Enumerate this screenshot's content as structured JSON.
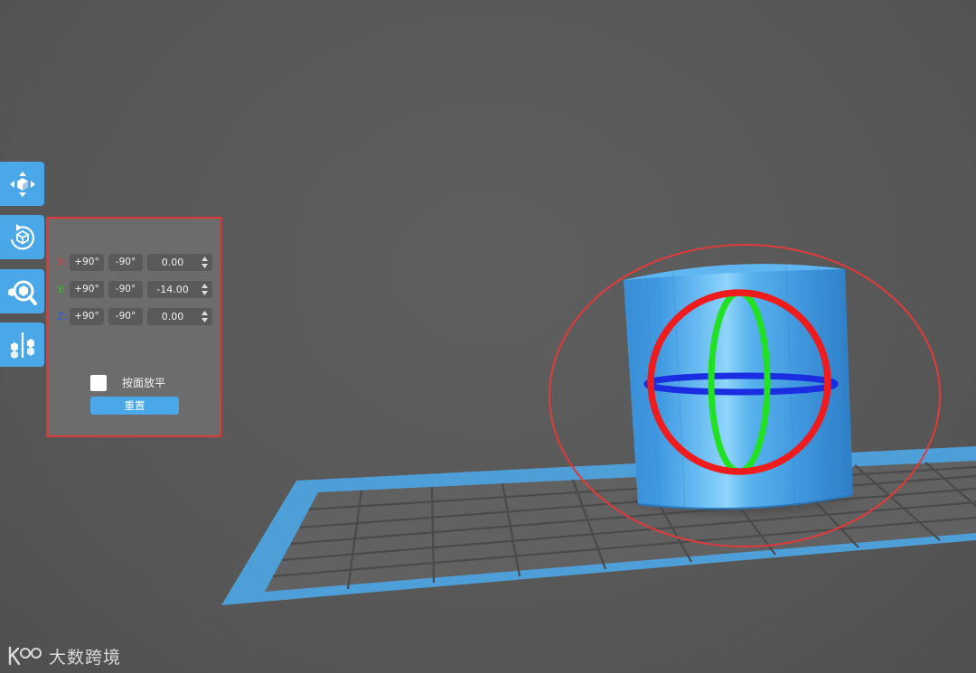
{
  "toolbar": {
    "items": [
      {
        "name": "move",
        "icon": "move-icon"
      },
      {
        "name": "rotate",
        "icon": "rotate-icon",
        "active": true
      },
      {
        "name": "scale",
        "icon": "scale-icon"
      },
      {
        "name": "mirror",
        "icon": "mirror-icon"
      }
    ]
  },
  "rotate_panel": {
    "axes": [
      {
        "label": "X:",
        "color": "#e0383a",
        "plus_label": "+90°",
        "minus_label": "-90°",
        "value": "0.00"
      },
      {
        "label": "Y:",
        "color": "#33cc33",
        "plus_label": "+90°",
        "minus_label": "-90°",
        "value": "-14.00"
      },
      {
        "label": "Z:",
        "color": "#2b55d9",
        "plus_label": "+90°",
        "minus_label": "-90°",
        "value": "0.00"
      }
    ],
    "lay_flat_label": "按面放平",
    "lay_flat_checked": false,
    "reset_label": "重置"
  },
  "colors": {
    "accent": "#4aa8e8",
    "background": "#585858",
    "panel": "#6c6c6c",
    "highlight_border": "#e0383a",
    "model": "#3e95dc",
    "ring_x": "#ee1c1c",
    "ring_y": "#22e022",
    "ring_z": "#1a2de0"
  },
  "watermark": {
    "text": "大数跨境"
  }
}
